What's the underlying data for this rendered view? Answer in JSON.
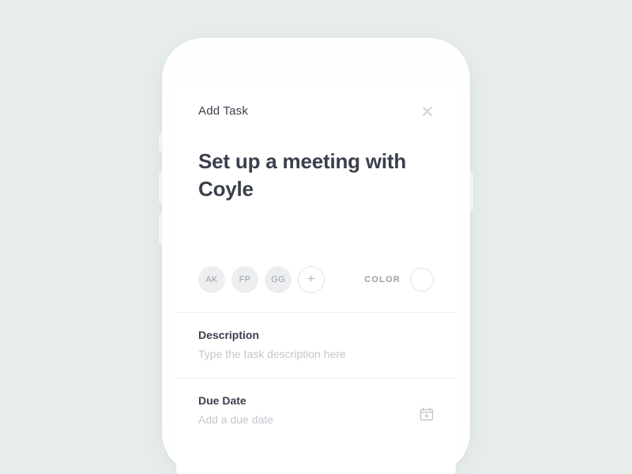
{
  "header": {
    "title": "Add Task"
  },
  "task": {
    "title": "Set up a meeting with Coyle"
  },
  "assignees": {
    "items": [
      {
        "initials": "AK"
      },
      {
        "initials": "FP"
      },
      {
        "initials": "GG"
      }
    ],
    "add_symbol": "+"
  },
  "color": {
    "label": "COLOR"
  },
  "description": {
    "label": "Description",
    "placeholder": "Type the task description here"
  },
  "due_date": {
    "label": "Due Date",
    "placeholder": "Add a due date"
  }
}
